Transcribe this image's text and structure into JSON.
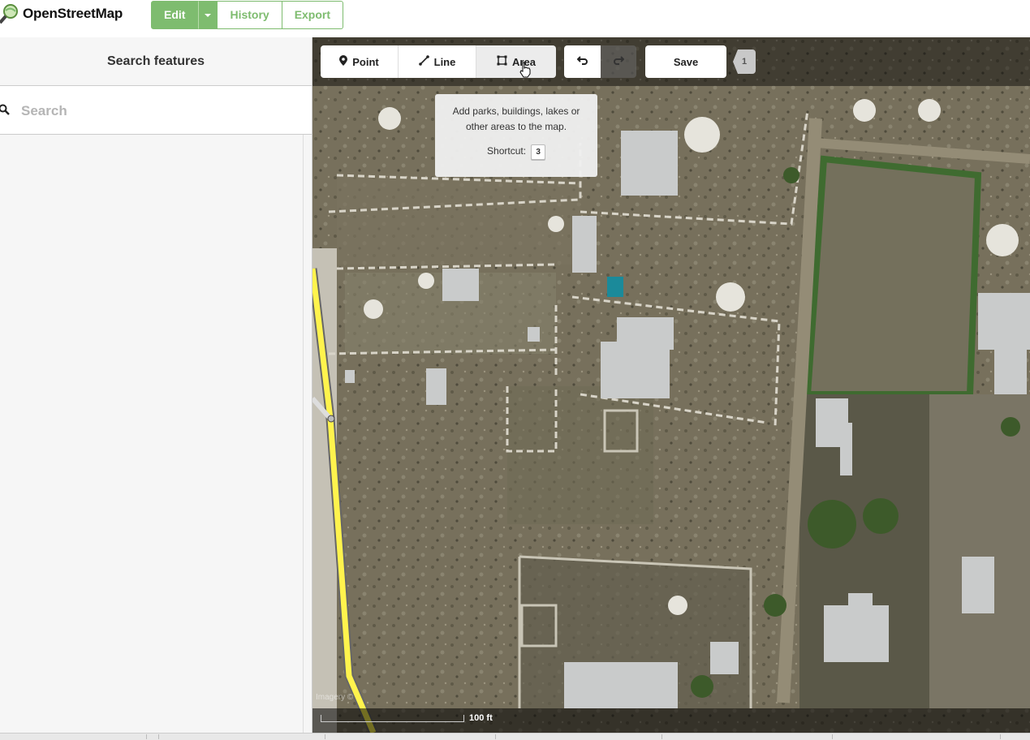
{
  "header": {
    "logo_text": "OpenStreetMap",
    "edit_label": "Edit",
    "history_label": "History",
    "export_label": "Export"
  },
  "sidebar": {
    "title": "Search features",
    "search_placeholder": "Search"
  },
  "toolbar": {
    "point_label": "Point",
    "line_label": "Line",
    "area_label": "Area",
    "save_label": "Save",
    "edit_count": "1"
  },
  "tooltip": {
    "description": "Add parks, buildings, lakes or other areas to the map.",
    "shortcut_label": "Shortcut:",
    "shortcut_key": "3"
  },
  "map": {
    "attribution": "Imagery ©",
    "scale_label": "100 ft",
    "highlight_color": "#fff34d",
    "osm_green": "#7ebc6f"
  }
}
